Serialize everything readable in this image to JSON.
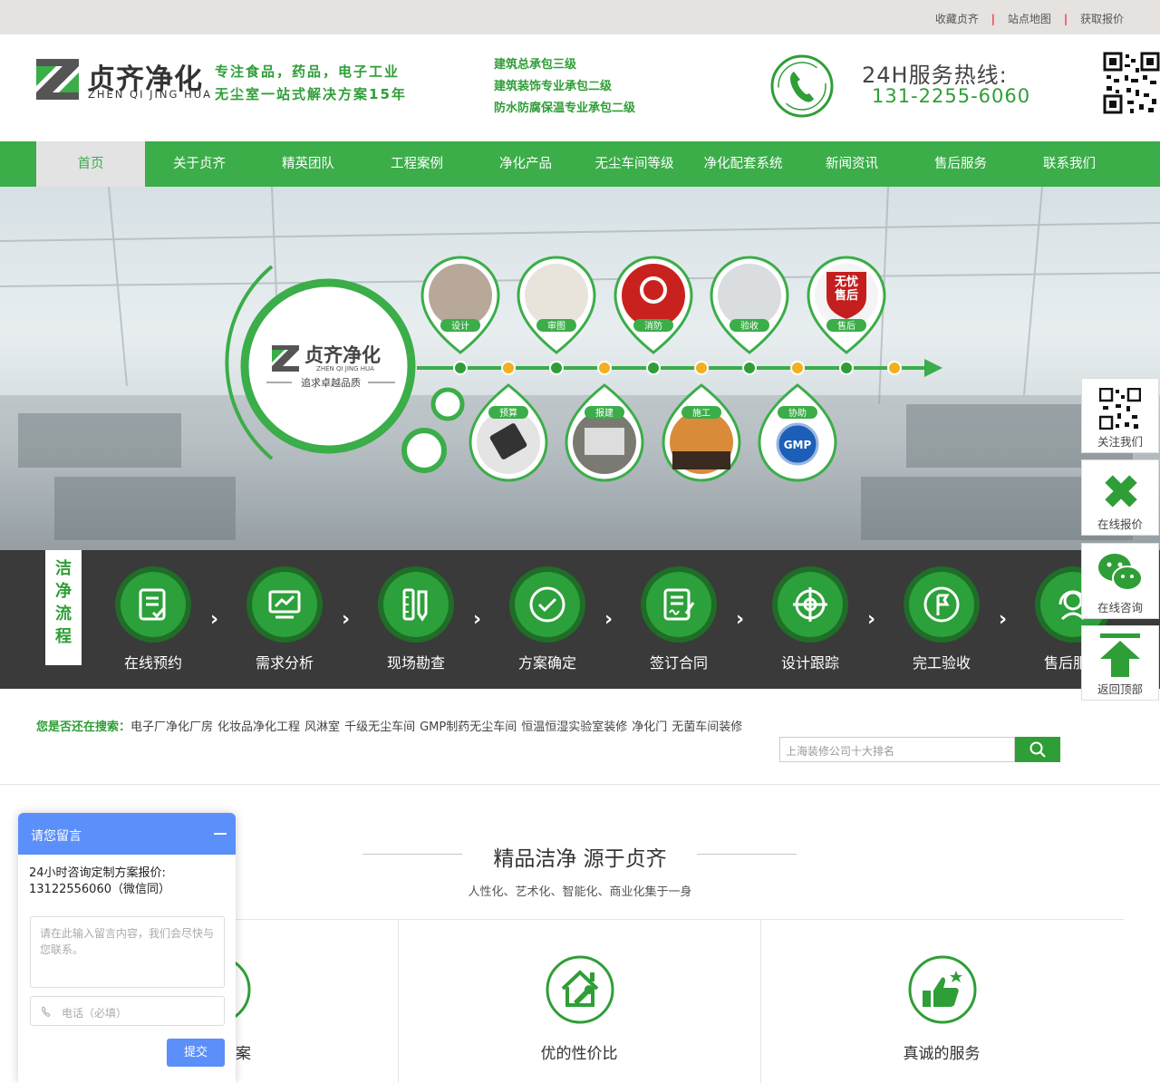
{
  "topbar": {
    "links": [
      "收藏贞齐",
      "站点地图",
      "获取报价"
    ],
    "separator": "|"
  },
  "header": {
    "logo_cn": "贞齐净化",
    "logo_en": "ZHEN QI JING HUA",
    "slogan": [
      "专注食品，药品，电子工业",
      "无尘室一站式解决方案15年"
    ],
    "quals": [
      "建筑总承包三级",
      "建筑装饰专业承包二级",
      "防水防腐保温专业承包二级"
    ],
    "hotline_title": "24H服务热线:",
    "hotline": "131-2255-6060"
  },
  "nav": {
    "items": [
      "首页",
      "关于贞齐",
      "精英团队",
      "工程案例",
      "净化产品",
      "无尘车间等级",
      "净化配套系统",
      "新闻资讯",
      "售后服务",
      "联系我们"
    ],
    "active_index": 0
  },
  "banner": {
    "logo_cn": "贞齐净化",
    "logo_en": "ZHEN QI JING HUA",
    "tagline": "追求卓越品质",
    "top_pins": [
      "设计",
      "审图",
      "消防",
      "验收",
      "售后"
    ],
    "badge": [
      "无忧",
      "售后"
    ],
    "bottom_pins": [
      "预算",
      "报建",
      "施工",
      "协助"
    ],
    "gmp": "GMP"
  },
  "process": {
    "tag": [
      "洁",
      "净",
      "流",
      "程"
    ],
    "steps": [
      "在线预约",
      "需求分析",
      "现场勘查",
      "方案确定",
      "签订合同",
      "设计跟踪",
      "完工验收",
      "售后服务"
    ]
  },
  "search": {
    "prompt": "您是否还在搜索：",
    "keywords": [
      "电子厂净化厂房",
      "化妆品净化工程",
      "风淋室",
      "千级无尘车间",
      "GMP制药无尘车间",
      "恒温恒湿实验室装修",
      "净化门",
      "无菌车间装修"
    ],
    "placeholder": "上海装修公司十大排名"
  },
  "section": {
    "title": "精品洁净 源于贞齐",
    "subtitle": "人性化、艺术化、智能化、商业化集于一身",
    "features": [
      "方案",
      "优的性价比",
      "真诚的服务"
    ]
  },
  "sidebar": {
    "items": [
      "关注我们",
      "在线报价",
      "在线咨询",
      "返回顶部"
    ]
  },
  "chat": {
    "title": "请您留言",
    "message": "24小时咨询定制方案报价: 13122556060（微信同）",
    "textarea_placeholder": "请在此输入留言内容，我们会尽快与您联系。",
    "phone_placeholder": "电话（必填）",
    "submit": "提交"
  },
  "colors": {
    "green": "#3bad49",
    "dark_green": "#2f9e37",
    "chat_blue": "#5b8ff9",
    "process_bg": "#3a3a3a"
  }
}
